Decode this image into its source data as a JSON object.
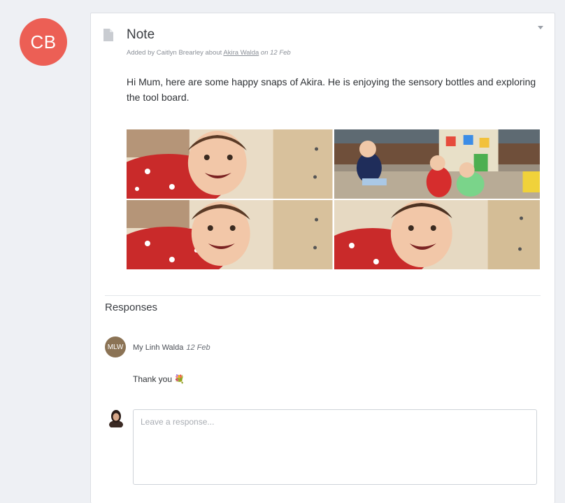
{
  "author_avatar": {
    "initials": "CB",
    "color": "#ec5f55"
  },
  "note": {
    "title": "Note",
    "meta": {
      "added_by_prefix": "Added by",
      "author": "Caitlyn Brearley",
      "about": "about",
      "child": "Akira Walda",
      "date_prefix": "on",
      "date": "12 Feb"
    },
    "body": "Hi Mum, here are some happy snaps of Akira. He is enjoying the sensory bottles and exploring the tool board.",
    "photos": [
      {
        "name": "photo-baby-smiling-1",
        "icon": "photo"
      },
      {
        "name": "photo-children-playing",
        "icon": "photo"
      },
      {
        "name": "photo-baby-smiling-2",
        "icon": "photo"
      },
      {
        "name": "photo-baby-smiling-3",
        "icon": "photo"
      }
    ]
  },
  "responses": {
    "title": "Responses",
    "items": [
      {
        "avatar_initials": "MLW",
        "name": "My Linh Walda",
        "date": "12 Feb",
        "text": "Thank you",
        "emoji": "💐"
      }
    ],
    "input_placeholder": "Leave a response..."
  },
  "colors": {
    "accent": "#ec5f55",
    "background": "#eef0f4",
    "card": "#ffffff"
  }
}
